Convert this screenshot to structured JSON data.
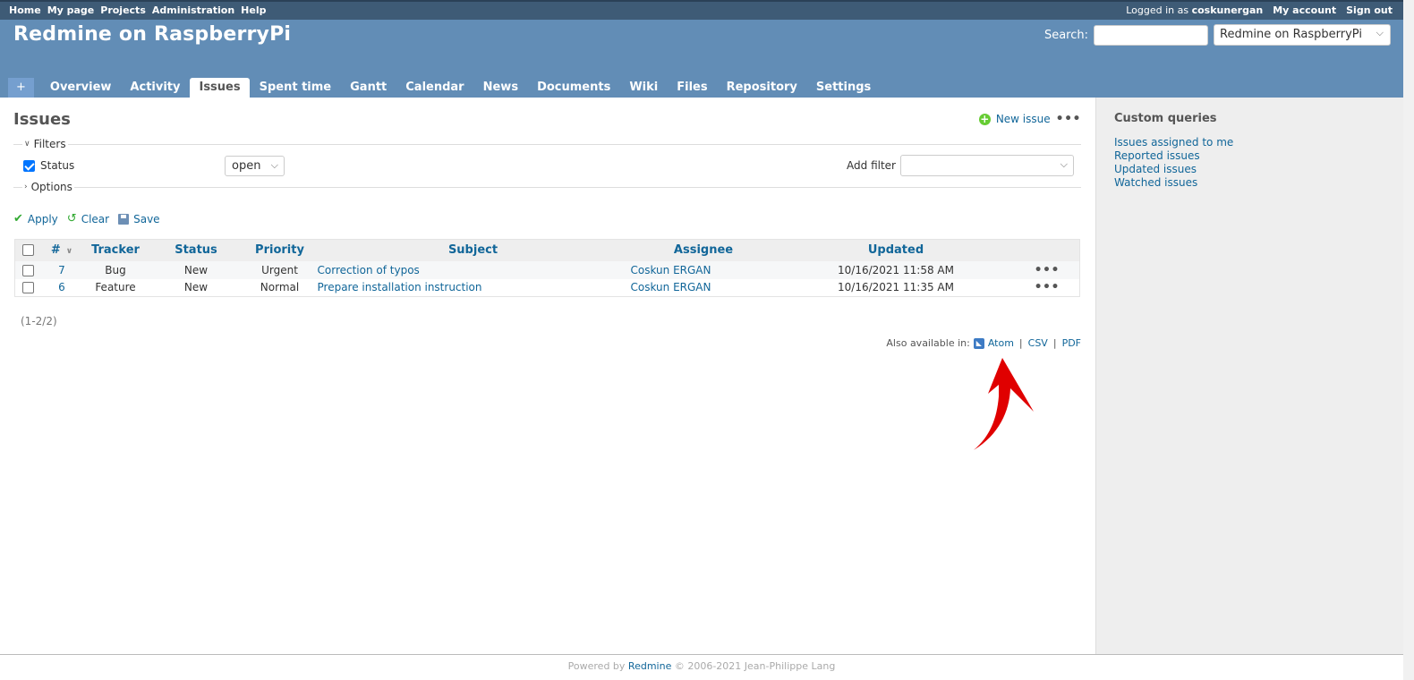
{
  "top_menu": {
    "left": [
      "Home",
      "My page",
      "Projects",
      "Administration",
      "Help"
    ],
    "logged_prefix": "Logged in as",
    "username": "coskunergan",
    "my_account": "My account",
    "sign_out": "Sign out"
  },
  "header": {
    "title": "Redmine on RaspberryPi",
    "search_label": "Search:",
    "search_value": "",
    "project_jump": "Redmine on RaspberryPi"
  },
  "main_menu": {
    "plus": "+",
    "tabs": [
      "Overview",
      "Activity",
      "Issues",
      "Spent time",
      "Gantt",
      "Calendar",
      "News",
      "Documents",
      "Wiki",
      "Files",
      "Repository",
      "Settings"
    ],
    "selected": "Issues"
  },
  "content": {
    "title": "Issues",
    "new_issue": "New issue",
    "more": "•••"
  },
  "filters": {
    "legend": "Filters",
    "status_label": "Status",
    "status_checked": true,
    "operator": "open",
    "add_filter_label": "Add filter",
    "add_filter_value": ""
  },
  "options": {
    "legend": "Options"
  },
  "buttons": {
    "apply": "Apply",
    "clear": "Clear",
    "save": "Save"
  },
  "table": {
    "headers": [
      "#",
      "Tracker",
      "Status",
      "Priority",
      "Subject",
      "Assignee",
      "Updated"
    ],
    "rows": [
      {
        "id": "7",
        "tracker": "Bug",
        "status": "New",
        "priority": "Urgent",
        "subject": "Correction of typos",
        "assignee": "Coskun ERGAN",
        "updated": "10/16/2021 11:58 AM"
      },
      {
        "id": "6",
        "tracker": "Feature",
        "status": "New",
        "priority": "Normal",
        "subject": "Prepare installation instruction",
        "assignee": "Coskun ERGAN",
        "updated": "10/16/2021 11:35 AM"
      }
    ],
    "row_menu": "•••"
  },
  "pagination": "(1-2/2)",
  "other_formats": {
    "label": "Also available in:",
    "atom": "Atom",
    "csv": "CSV",
    "pdf": "PDF",
    "sep": "|"
  },
  "sidebar": {
    "title": "Custom queries",
    "items": [
      "Issues assigned to me",
      "Reported issues",
      "Updated issues",
      "Watched issues"
    ]
  },
  "footer": {
    "powered_by": "Powered by",
    "redmine": "Redmine",
    "copyright": "© 2006-2021 Jean-Philippe Lang"
  },
  "colors": {
    "header_bg": "#628db6",
    "top_menu_bg": "#3e5b76",
    "link": "#1166aa",
    "annotation_arrow": "#e00000"
  }
}
